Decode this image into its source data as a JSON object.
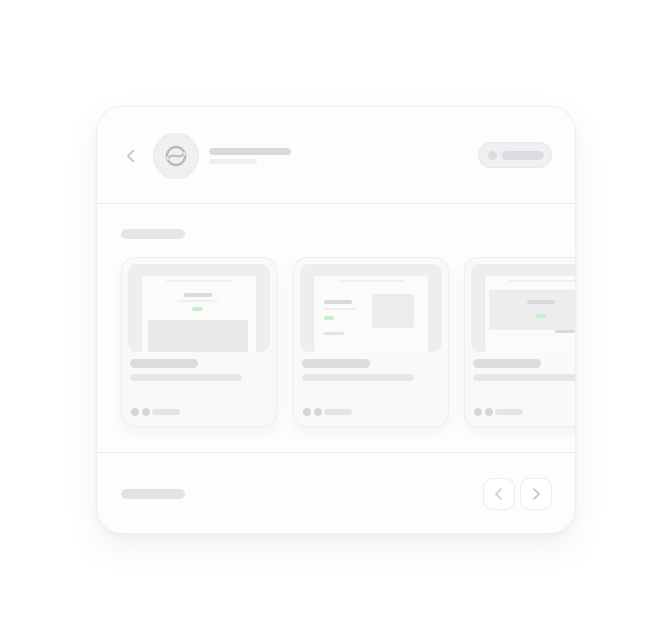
{
  "icons": {
    "back": "chevron-left-icon",
    "logo": "sync-logo-icon",
    "prev": "chevron-left-icon",
    "next": "chevron-right-icon"
  },
  "colors": {
    "placeholder": "#e4e4e7",
    "accent_green": "#c9eecb",
    "card_background": "#fdfdfd"
  },
  "templates": [
    {
      "layout": "centered"
    },
    {
      "layout": "split-with-image"
    },
    {
      "layout": "banner"
    }
  ]
}
